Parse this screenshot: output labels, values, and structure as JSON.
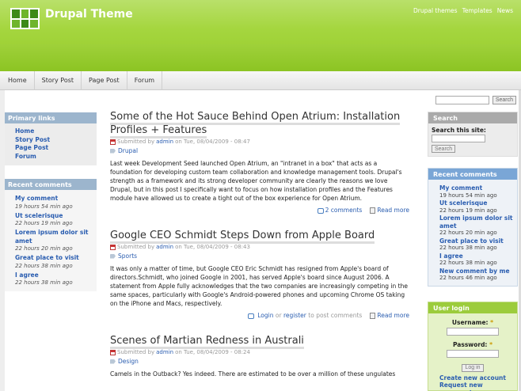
{
  "site": {
    "name": "Drupal Theme",
    "secondary_links": [
      "Drupal themes",
      "Templates",
      "News"
    ]
  },
  "nav": [
    "Home",
    "Story Post",
    "Page Post",
    "Forum"
  ],
  "top_search": {
    "button": "Search"
  },
  "primary_links": {
    "title": "Primary links",
    "items": [
      "Home",
      "Story Post",
      "Page Post",
      "Forum"
    ]
  },
  "left_recent": {
    "title": "Recent comments",
    "items": [
      {
        "label": "My comment",
        "meta": "19 hours 54 min ago"
      },
      {
        "label": "Ut scelerisque",
        "meta": "22 hours 19 min ago"
      },
      {
        "label": "Lorem ipsum dolor sit amet",
        "meta": "22 hours 20 min ago"
      },
      {
        "label": "Great place to visit",
        "meta": "22 hours 38 min ago"
      },
      {
        "label": "I agree",
        "meta": "22 hours 38 min ago"
      }
    ]
  },
  "posts": [
    {
      "title": "Some of the Hot Sauce Behind Open Atrium: Installation Profiles + Features",
      "submitted_prefix": "Submitted by",
      "author": "admin",
      "date": "on Tue, 08/04/2009 - 08:47",
      "tag": "Drupal",
      "body": "Last week Development Seed launched Open Atrium, an \"intranet in a box\" that acts as a foundation for developing custom team collaboration and knowledge management tools. Drupal's strength as a framework and its strong developer community are clearly the reasons we love Drupal, but in this post I specifically want to focus on how installation profiles and the Features module have allowed us to create a tight out of the box experience for Open Atrium.",
      "comments": "2 comments",
      "read_more": "Read more"
    },
    {
      "title": "Google CEO Schmidt Steps Down from Apple Board",
      "submitted_prefix": "Submitted by",
      "author": "admin",
      "date": "on Tue, 08/04/2009 - 08:43",
      "tag": "Sports",
      "body": "It was only a matter of time, but Google CEO Eric Schmidt has resigned from Apple's board of directors.Schmidt, who joined Google in 2001, has served Apple's board since August 2006. A statement from Apple fully acknowledges that the two companies are increasingly competing in the same spaces, particularly with Google's Android-powered phones and upcoming Chrome OS taking on the iPhone and Macs, respectively.",
      "login": "Login",
      "or": "or",
      "register": "register",
      "to_post": "to post comments",
      "read_more": "Read more"
    },
    {
      "title": "Scenes of Martian Redness in Australi",
      "submitted_prefix": "Submitted by",
      "author": "admin",
      "date": "on Tue, 08/04/2009 - 08:24",
      "tag": "Design",
      "body": "Camels in the Outback? Yes indeed. There are estimated to be over a million of these ungulates"
    }
  ],
  "right_search": {
    "title": "Search",
    "label": "Search this site:",
    "button": "Search"
  },
  "right_recent": {
    "title": "Recent comments",
    "items": [
      {
        "label": "My comment",
        "meta": "19 hours 54 min ago"
      },
      {
        "label": "Ut scelerisque",
        "meta": "22 hours 19 min ago"
      },
      {
        "label": "Lorem ipsum dolor sit amet",
        "meta": "22 hours 20 min ago"
      },
      {
        "label": "Great place to visit",
        "meta": "22 hours 38 min ago"
      },
      {
        "label": "I agree",
        "meta": "22 hours 38 min ago"
      },
      {
        "label": "New comment by me",
        "meta": "22 hours 46 min ago"
      }
    ]
  },
  "user_login": {
    "title": "User login",
    "username_label": "Username:",
    "password_label": "Password:",
    "required_mark": "*",
    "button": "Log in",
    "links": [
      "Create new account",
      "Request new password"
    ]
  }
}
